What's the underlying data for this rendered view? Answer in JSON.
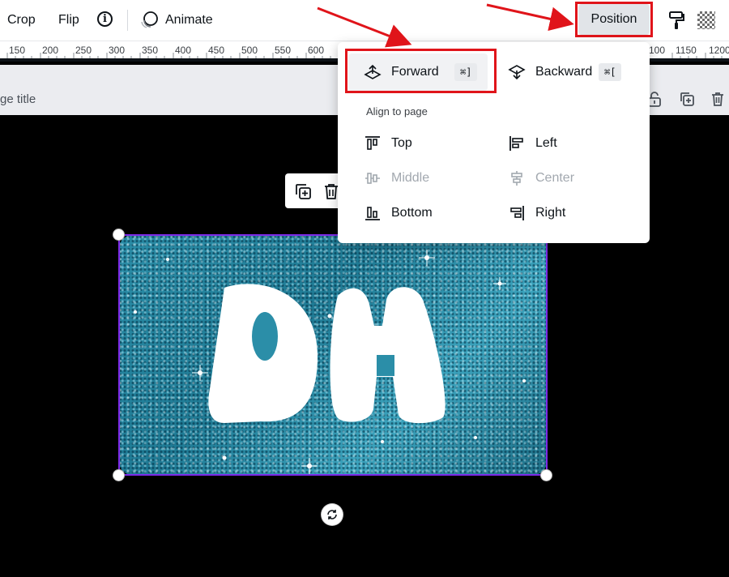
{
  "toolbar": {
    "crop_label": "Crop",
    "flip_label": "Flip",
    "info_glyph": "i",
    "animate_label": "Animate",
    "position_label": "Position"
  },
  "ruler": {
    "left_numbers": [
      "150",
      "200",
      "250",
      "300",
      "350",
      "400",
      "450",
      "500",
      "550",
      "600"
    ],
    "right_numbers": [
      "100",
      "1150",
      "1200"
    ]
  },
  "page": {
    "title_fragment": "ge title"
  },
  "canvas": {
    "text_art": "DH"
  },
  "dropdown": {
    "forward_label": "Forward",
    "forward_shortcut": "⌘]",
    "backward_label": "Backward",
    "backward_shortcut": "⌘[",
    "align_heading": "Align to page",
    "top_label": "Top",
    "left_label": "Left",
    "middle_label": "Middle",
    "center_label": "Center",
    "bottom_label": "Bottom",
    "right_label": "Right"
  },
  "colors": {
    "accent_selection": "#7d2ae8",
    "annotation_red": "#e0141a",
    "glitter_teal": "#2b8ea8"
  }
}
